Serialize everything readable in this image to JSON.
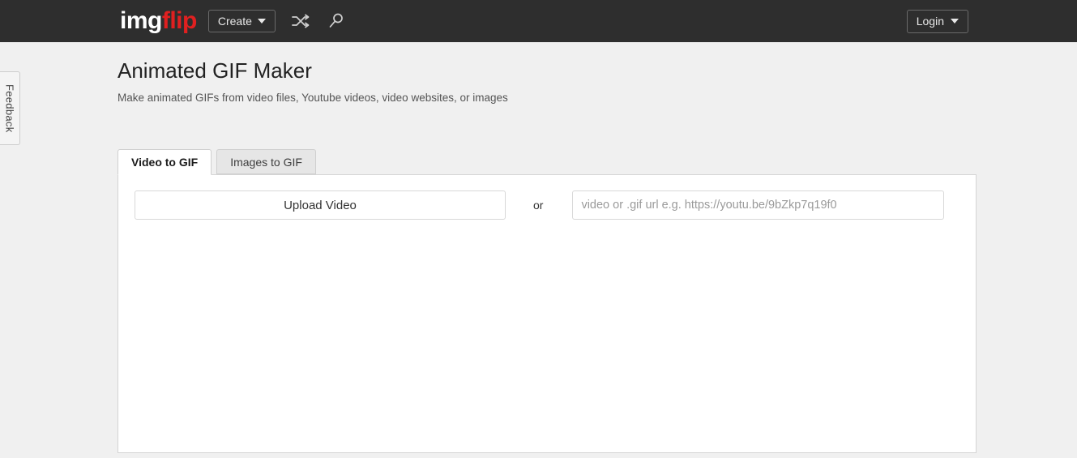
{
  "header": {
    "logo_img": "img",
    "logo_flip": "flip",
    "create_label": "Create",
    "shuffle_icon": "shuffle-icon",
    "search_icon": "search-icon",
    "login_label": "Login"
  },
  "feedback": {
    "label": "Feedback"
  },
  "page": {
    "title": "Animated GIF Maker",
    "subtitle": "Make animated GIFs from video files, Youtube videos, video websites, or images"
  },
  "tabs": [
    {
      "label": "Video to GIF",
      "active": true
    },
    {
      "label": "Images to GIF",
      "active": false
    }
  ],
  "main": {
    "upload_label": "Upload Video",
    "or_label": "or",
    "url_placeholder": "video or .gif url e.g. https://youtu.be/9bZkp7q19f0",
    "url_value": ""
  },
  "colors": {
    "header_bg": "#2e2e2e",
    "page_bg": "#f0f0f0",
    "brand_red": "#e02020",
    "panel_bg": "#ffffff",
    "tab_inactive_bg": "#e6e6e6",
    "border": "#d4d4d4"
  }
}
